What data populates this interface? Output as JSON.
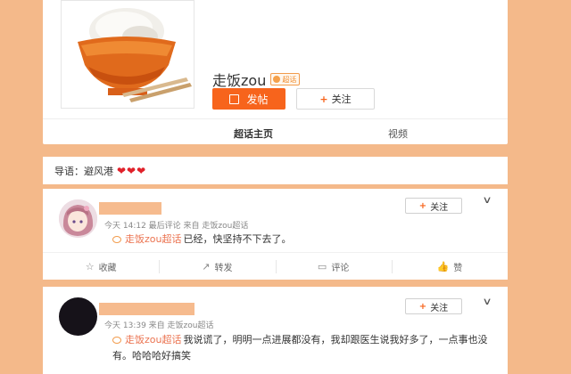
{
  "header": {
    "name": "走饭zou",
    "badge": "超话",
    "post_button": "发帖",
    "follow_button": "关注",
    "tabs": [
      {
        "label": "超话主页"
      },
      {
        "label": "视频"
      }
    ]
  },
  "intro": {
    "label": "导语：避风港",
    "hearts": "❤❤❤"
  },
  "posts": [
    {
      "meta": "今天 14:12 最后评论 来自 走饭zou超话",
      "topic": "走饭zou超话",
      "text": "已经，快坚持不下去了。",
      "follow": "关注"
    },
    {
      "meta": "今天 13:39 来自 走饭zou超话",
      "topic": "走饭zou超话",
      "text": "我说谎了，明明一点进展都没有，我却跟医生说我好多了，一点事也没有。哈哈哈好搞笑",
      "follow": "关注"
    }
  ],
  "actions": {
    "collect": "收藏",
    "repost": "转发",
    "comment": "评论",
    "like": "赞"
  },
  "colors": {
    "background": "#f4b98a",
    "accent": "#f7641c",
    "topic": "#eb7350",
    "heart": "#e0212a"
  }
}
